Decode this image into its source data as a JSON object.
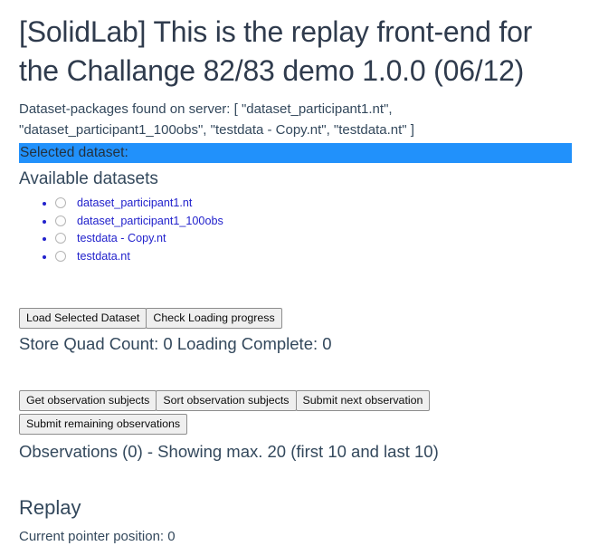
{
  "header": {
    "title": "[SolidLab] This is the replay front-end for the Challange 82/83 demo 1.0.0 (06/12)"
  },
  "server": {
    "packages_line": "Dataset-packages found on server: [ \"dataset_participant1.nt\", \"dataset_participant1_100obs\", \"testdata - Copy.nt\", \"testdata.nt\" ]"
  },
  "selection": {
    "label": "Selected dataset:",
    "value": "",
    "highlight_color": "#2191fb"
  },
  "available": {
    "heading": "Available datasets",
    "items": [
      {
        "label": "dataset_participant1.nt",
        "selected": false
      },
      {
        "label": "dataset_participant1_100obs",
        "selected": false
      },
      {
        "label": "testdata - Copy.nt",
        "selected": false
      },
      {
        "label": "testdata.nt",
        "selected": false
      }
    ],
    "link_color": "#2222cc"
  },
  "loading": {
    "buttons": [
      "Load Selected Dataset",
      "Check Loading progress"
    ],
    "status": "Store Quad Count: 0 Loading Complete: 0"
  },
  "observations": {
    "buttons_row1": [
      "Get observation subjects",
      "Sort observation subjects",
      "Submit next observation"
    ],
    "buttons_row2": [
      "Submit remaining observations"
    ],
    "status": "Observations (0) - Showing max. 20 (first 10 and last 10)"
  },
  "replay": {
    "heading": "Replay",
    "pointer": "Current pointer position: 0"
  }
}
